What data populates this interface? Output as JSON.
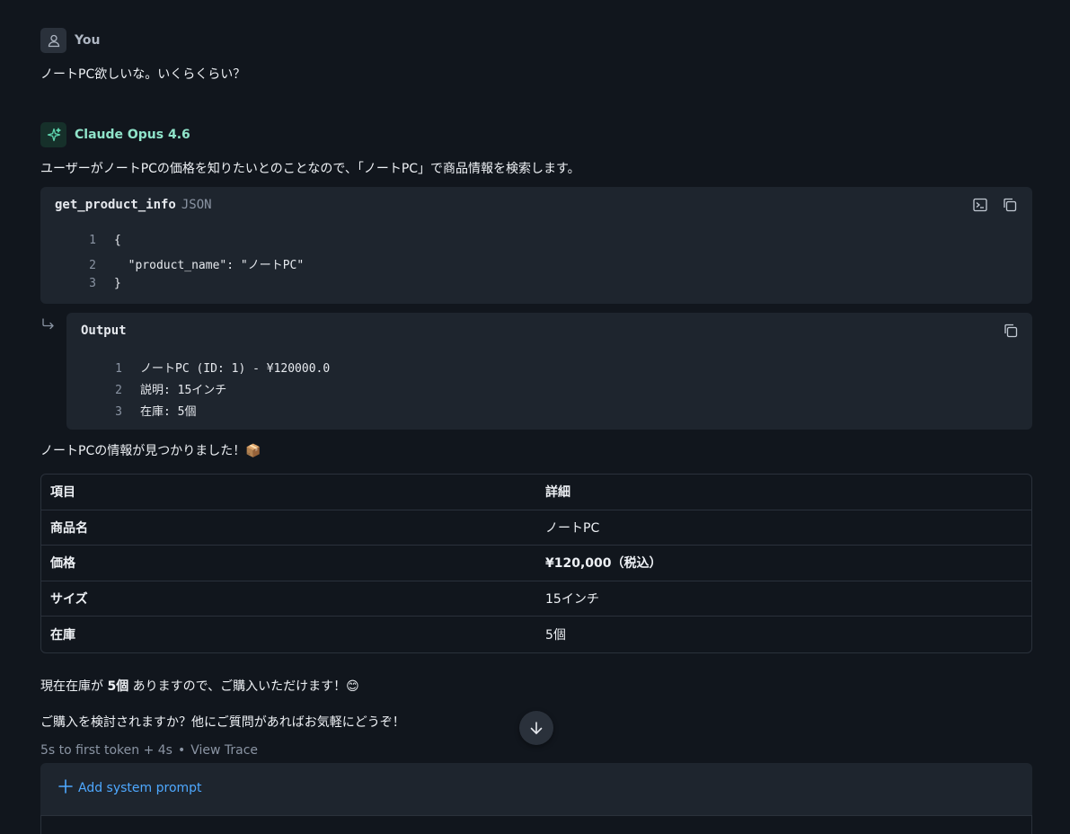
{
  "user_message": {
    "sender": "You",
    "text": "ノートPC欲しいな。いくらくらい？"
  },
  "assistant_message": {
    "sender": "Claude Opus 4.6",
    "intro": "ユーザーがノートPCの価格を知りたいとのことなので、「ノートPC」で商品情報を検索します。",
    "tool_call": {
      "name": "get_product_info",
      "lang": "JSON",
      "lines": [
        {
          "n": "1",
          "code": "{"
        },
        {
          "n": "2",
          "code": "  \"product_name\": \"ノートPC\""
        },
        {
          "n": "3",
          "code": "}"
        }
      ]
    },
    "tool_output": {
      "title": "Output",
      "lines": [
        {
          "n": "1",
          "code": "ノートPC (ID: 1) - ¥120000.0"
        },
        {
          "n": "2",
          "code": "説明: 15インチ"
        },
        {
          "n": "3",
          "code": "在庫: 5個"
        }
      ]
    },
    "found_text": "ノートPCの情報が見つかりました！",
    "found_emoji": "📦",
    "table": {
      "headers": [
        "項目",
        "詳細"
      ],
      "rows": [
        [
          "商品名",
          "ノートPC"
        ],
        [
          "価格",
          "¥120,000（税込）"
        ],
        [
          "サイズ",
          "15インチ"
        ],
        [
          "在庫",
          "5個"
        ]
      ]
    },
    "stock_pre": "現在在庫が ",
    "stock_bold": "5個",
    "stock_post": " ありますので、ご購入いただけます！",
    "stock_emoji": "😊",
    "closing": "ご購入を検討されますか？他にご質問があればお気軽にどうぞ！",
    "meta": {
      "timing": "5s to first token + 4s",
      "separator": "•",
      "view_trace": "View Trace"
    }
  },
  "system_prompt": {
    "add_label": "Add system prompt"
  },
  "colors": {
    "accent": "#4ea8ff",
    "ai_name": "#8fe3c9",
    "background": "#11161d",
    "panel": "#1e252e"
  }
}
